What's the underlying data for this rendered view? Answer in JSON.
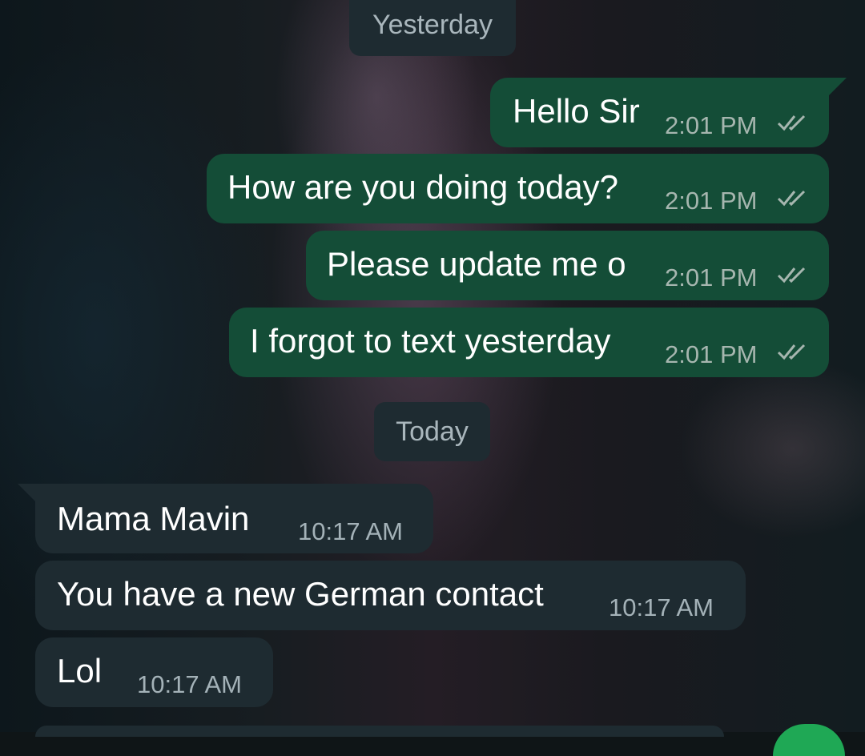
{
  "date_separators": {
    "yesterday": "Yesterday",
    "today": "Today"
  },
  "outgoing": [
    {
      "text": "Hello Sir",
      "time": "2:01 PM",
      "status_icon": "double-check-icon"
    },
    {
      "text": "How are you doing today?",
      "time": "2:01 PM",
      "status_icon": "double-check-icon"
    },
    {
      "text": "Please update me o",
      "time": "2:01 PM",
      "status_icon": "double-check-icon"
    },
    {
      "text": "I forgot to text yesterday",
      "time": "2:01 PM",
      "status_icon": "double-check-icon"
    }
  ],
  "incoming": [
    {
      "text": "Mama Mavin",
      "time": "10:17 AM"
    },
    {
      "text": "You have a new German contact",
      "time": "10:17 AM"
    },
    {
      "text": "Lol",
      "time": "10:17 AM"
    }
  ],
  "colors": {
    "outgoing_bubble": "#144d37",
    "incoming_bubble": "#1e2b31",
    "date_chip": "#1e2b31",
    "fab_accent": "#1fa855"
  }
}
